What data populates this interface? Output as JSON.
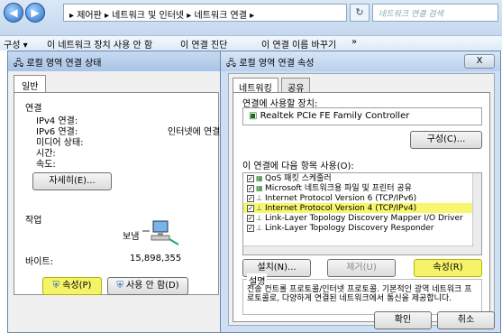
{
  "explorer": {
    "breadcrumb": "▸ 제어판 ▸ 네트워크 및 인터넷 ▸ 네트워크 연결 ▸",
    "search_placeholder": "네트워크 연결 검색",
    "cmd_items": [
      "구성 ▾",
      "이 네트워크 장치 사용 안 함",
      "이 연결 진단",
      "이 연결 이름 바꾸기",
      "»"
    ]
  },
  "status_dialog": {
    "title": "로컬 영역 연결 상태",
    "tab": "일반",
    "section_connection": "연결",
    "ipv4_label": "IPv4 연결:",
    "ipv6_label": "IPv6 연결:",
    "media_label": "미디어 상태:",
    "time_label": "시간:",
    "speed_label": "속도:",
    "ipv4_value": "인터넷에 연결",
    "details_btn": "자세히(E)...",
    "section_activity": "작업",
    "sent_label": "보냄",
    "bytes_label": "바이트:",
    "bytes_value": "15,898,355",
    "properties_btn": "속성(P)",
    "disable_btn": "사용 안 함(D)"
  },
  "props_dialog": {
    "title": "로컬 영역 연결 속성",
    "close": "X",
    "tabs": [
      "네트워킹",
      "공유"
    ],
    "connect_using_label": "연결에 사용할 장치:",
    "device": "Realtek PCIe FE Family Controller",
    "configure_btn": "구성(C)...",
    "items_label": "이 연결에 다음 항목 사용(O):",
    "items": [
      "QoS 패킷 스케줄러",
      "Microsoft 네트워크용 파일 및 프린터 공유",
      "Internet Protocol Version 6 (TCP/IPv6)",
      "Internet Protocol Version 4 (TCP/IPv4)",
      "Link-Layer Topology Discovery Mapper I/O Driver",
      "Link-Layer Topology Discovery Responder"
    ],
    "selected_index": 3,
    "install_btn": "설치(N)...",
    "uninstall_btn": "제거(U)",
    "properties_btn": "속성(R)",
    "desc_label": "설명",
    "desc_text": "전송 컨트롤 프로토콜/인터넷 프로토콜. 기본적인 광역 네트워크 프로토콜로, 다양하게 연결된 네트워크에서 통신을 제공합니다.",
    "ok_btn": "확인",
    "cancel_btn": "취소"
  },
  "colors": {
    "highlight": "#f4f36a",
    "titlebar": "#b9d0ec"
  }
}
